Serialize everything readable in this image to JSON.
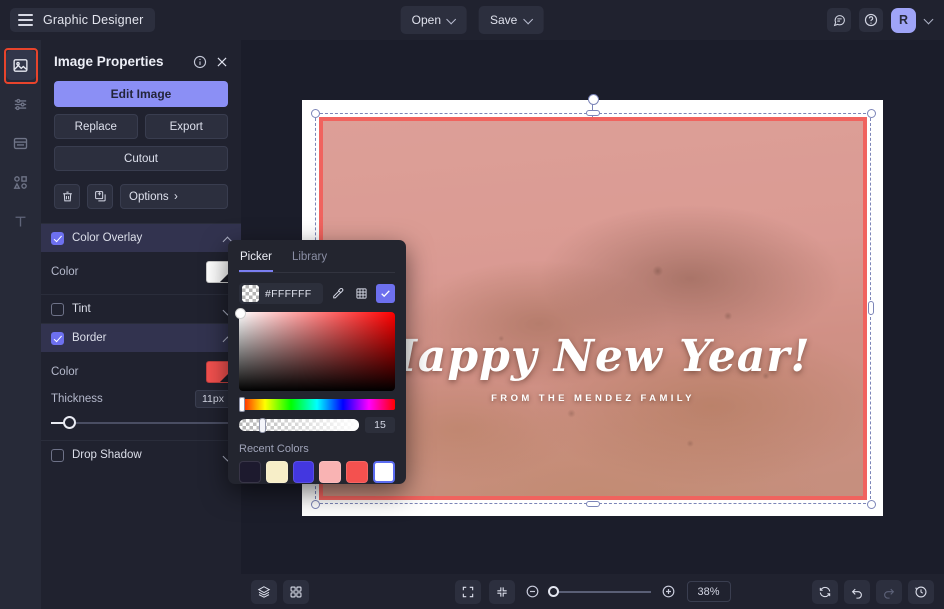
{
  "topbar": {
    "brand": "Graphic Designer",
    "menu_icon": "hamburger-icon",
    "open_label": "Open",
    "save_label": "Save",
    "comment_icon": "comment-icon",
    "help_icon": "help-icon",
    "avatar_initial": "R"
  },
  "rail": {
    "items": [
      {
        "icon": "image-icon",
        "name": "image"
      },
      {
        "icon": "adjustments-icon",
        "name": "adjust"
      },
      {
        "icon": "page-icon",
        "name": "page"
      },
      {
        "icon": "shapes-icon",
        "name": "shapes"
      },
      {
        "icon": "text-icon",
        "name": "text"
      }
    ]
  },
  "panel": {
    "title": "Image Properties",
    "info_icon": "info-icon",
    "close_icon": "close-icon",
    "edit_image": "Edit Image",
    "replace": "Replace",
    "export": "Export",
    "cutout": "Cutout",
    "delete_icon": "trash-icon",
    "duplicate_icon": "duplicate-icon",
    "options": "Options",
    "sections": [
      {
        "label": "Color Overlay",
        "checked": true,
        "expanded": true,
        "color_label": "Color",
        "color_value": "#FFFFFF"
      },
      {
        "label": "Tint",
        "checked": false,
        "expanded": false
      },
      {
        "label": "Border",
        "checked": true,
        "expanded": true,
        "color_label": "Color",
        "color_value": "#F0635E",
        "thickness_label": "Thickness",
        "thickness_value": "11px"
      },
      {
        "label": "Drop Shadow",
        "checked": false,
        "expanded": false
      }
    ]
  },
  "picker": {
    "tab_picker": "Picker",
    "tab_library": "Library",
    "hex": "#FFFFFF",
    "eyedropper_icon": "eyedropper-icon",
    "grid_icon": "grid-icon",
    "confirm_icon": "check-icon",
    "alpha_value": "15",
    "recent_title": "Recent Colors",
    "recent_colors": [
      "#1d1a2e",
      "#f7eec8",
      "#4337e0",
      "#f9b3b3",
      "#f4514f",
      "#ffffff"
    ],
    "selected_recent_index": 5
  },
  "canvas": {
    "headline": "Happy New Year!",
    "subline": "FROM THE MENDEZ FAMILY",
    "border_color": "#F0635E"
  },
  "bottombar": {
    "layers_icon": "layers-icon",
    "grid_icon": "grid-view-icon",
    "fit_icon": "fit-screen-icon",
    "collapse_icon": "shrink-icon",
    "zoom_out_icon": "zoom-out-icon",
    "zoom_in_icon": "zoom-in-icon",
    "zoom_value": "38%",
    "sync_icon": "sync-icon",
    "undo_icon": "undo-icon",
    "redo_icon": "redo-icon",
    "history_icon": "history-icon"
  }
}
